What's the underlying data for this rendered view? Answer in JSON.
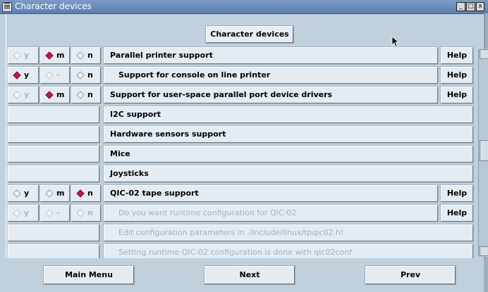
{
  "window": {
    "title": "Character devices",
    "controls": [
      "_",
      "□",
      "x"
    ]
  },
  "heading": {
    "label": "Character devices"
  },
  "rows": [
    {
      "tristate": {
        "y": "y",
        "m": "m",
        "n": "n",
        "selected": "m",
        "enabled": [
          "m",
          "n"
        ],
        "disabled_y": true
      },
      "label": "Parallel printer support",
      "help": "Help",
      "disabled": false
    },
    {
      "tristate": {
        "y": "y",
        "m": "-",
        "n": "n",
        "selected": "y",
        "disabled_m": true
      },
      "label": "Support for console on line printer",
      "help": "Help",
      "disabled": false,
      "indent": true
    },
    {
      "tristate": {
        "y": "y",
        "m": "m",
        "n": "n",
        "selected": "m",
        "disabled_y": true
      },
      "label": "Support for user-space parallel port device drivers",
      "help": "Help",
      "disabled": false
    },
    {
      "label": "I2C support",
      "submenu": true
    },
    {
      "label": "Hardware sensors support",
      "submenu": true
    },
    {
      "label": "Mice",
      "submenu": true
    },
    {
      "label": "Joysticks",
      "submenu": true
    },
    {
      "tristate": {
        "y": "y",
        "m": "m",
        "n": "n",
        "selected": "n"
      },
      "label": "QIC-02 tape support",
      "help": "Help",
      "disabled": false
    },
    {
      "tristate": {
        "y": "y",
        "m": "-",
        "n": "n",
        "selected": "",
        "all_disabled": true
      },
      "label": "Do you want runtime configuration for QIC-02",
      "help": "Help",
      "disabled": true,
      "indent": true
    },
    {
      "label": "Edit configuration parameters in ./include/linux/tpqic02.h!",
      "submenu": true,
      "disabled": true,
      "indent": true
    },
    {
      "label": "Setting runtime QIC-02 configuration is done with qic02conf",
      "submenu": true,
      "disabled": true,
      "indent": true
    }
  ],
  "nav": {
    "main_menu": "Main Menu",
    "next": "Next",
    "prev": "Prev"
  }
}
